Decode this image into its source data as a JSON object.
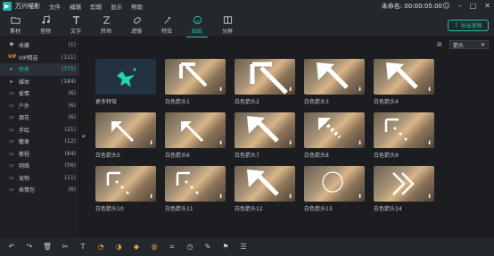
{
  "app": {
    "title": "万兴喵影",
    "project": "未命名: 00:00:05:00"
  },
  "menu": [
    "文件",
    "编辑",
    "剪辑",
    "显示",
    "帮助"
  ],
  "toolbar": {
    "tools": [
      {
        "label": "素材",
        "icon": "folder-icon"
      },
      {
        "label": "音频",
        "icon": "music-icon"
      },
      {
        "label": "文字",
        "icon": "text-icon"
      },
      {
        "label": "转场",
        "icon": "transition-icon"
      },
      {
        "label": "滤镜",
        "icon": "filter-icon"
      },
      {
        "label": "特效",
        "icon": "effects-icon"
      },
      {
        "label": "贴纸",
        "icon": "sticker-icon",
        "active": true
      },
      {
        "label": "分屏",
        "icon": "split-screen-icon"
      }
    ],
    "export_label": "导出视频"
  },
  "sidebar": {
    "items": [
      {
        "label": "收藏",
        "count": "(1)",
        "icon": "heart"
      },
      {
        "label": "VIP精选",
        "count": "(111)",
        "icon": "vip"
      },
      {
        "label": "所有",
        "count": "(375)",
        "icon": "folder",
        "active": true
      },
      {
        "label": "媒体",
        "count": "(184)",
        "icon": "arrow"
      },
      {
        "label": "爱情",
        "count": "(6)",
        "icon": "folder"
      },
      {
        "label": "户外",
        "count": "(6)",
        "icon": "folder"
      },
      {
        "label": "烟花",
        "count": "(6)",
        "icon": "folder"
      },
      {
        "label": "手绘",
        "count": "(21)",
        "icon": "folder"
      },
      {
        "label": "徽章",
        "count": "(12)",
        "icon": "folder"
      },
      {
        "label": "教程",
        "count": "(64)",
        "icon": "folder"
      },
      {
        "label": "网络",
        "count": "(56)",
        "icon": "folder"
      },
      {
        "label": "宠物",
        "count": "(11)",
        "icon": "folder"
      },
      {
        "label": "表情包",
        "count": "(6)",
        "icon": "folder"
      }
    ]
  },
  "search": {
    "value": "箭头"
  },
  "stickers": [
    {
      "label": "更多特效",
      "kind": "more"
    },
    {
      "label": "白色箭头1",
      "kind": "arrow-nw"
    },
    {
      "label": "白色箭头2",
      "kind": "arrow-nw-big"
    },
    {
      "label": "白色箭头3",
      "kind": "arrow-nw-bold"
    },
    {
      "label": "白色箭头4",
      "kind": "arrow-nw-bold"
    },
    {
      "label": "白色箭头5",
      "kind": "arrow-nw-small"
    },
    {
      "label": "白色箭头6",
      "kind": "arrow-nw-small"
    },
    {
      "label": "白色箭头7",
      "kind": "arrow-nw-bold"
    },
    {
      "label": "白色箭头8",
      "kind": "arrow-nw-dots"
    },
    {
      "label": "白色箭头9",
      "kind": "arrow-dots"
    },
    {
      "label": "白色箭头10",
      "kind": "arrow-dots"
    },
    {
      "label": "白色箭头11",
      "kind": "arrow-dots"
    },
    {
      "label": "白色箭头12",
      "kind": "arrow-nw-bold"
    },
    {
      "label": "白色箭头13",
      "kind": "circle"
    },
    {
      "label": "白色箭头14",
      "kind": "chevrons"
    }
  ],
  "bottom_tools": [
    "undo-icon",
    "redo-icon",
    "delete-icon",
    "cut-icon",
    "text-edit-icon",
    "speed-icon",
    "color-icon",
    "keyframe-icon",
    "mask-icon",
    "crop-icon",
    "speedometer-icon",
    "pen-icon",
    "marker-icon",
    "settings-icon"
  ]
}
